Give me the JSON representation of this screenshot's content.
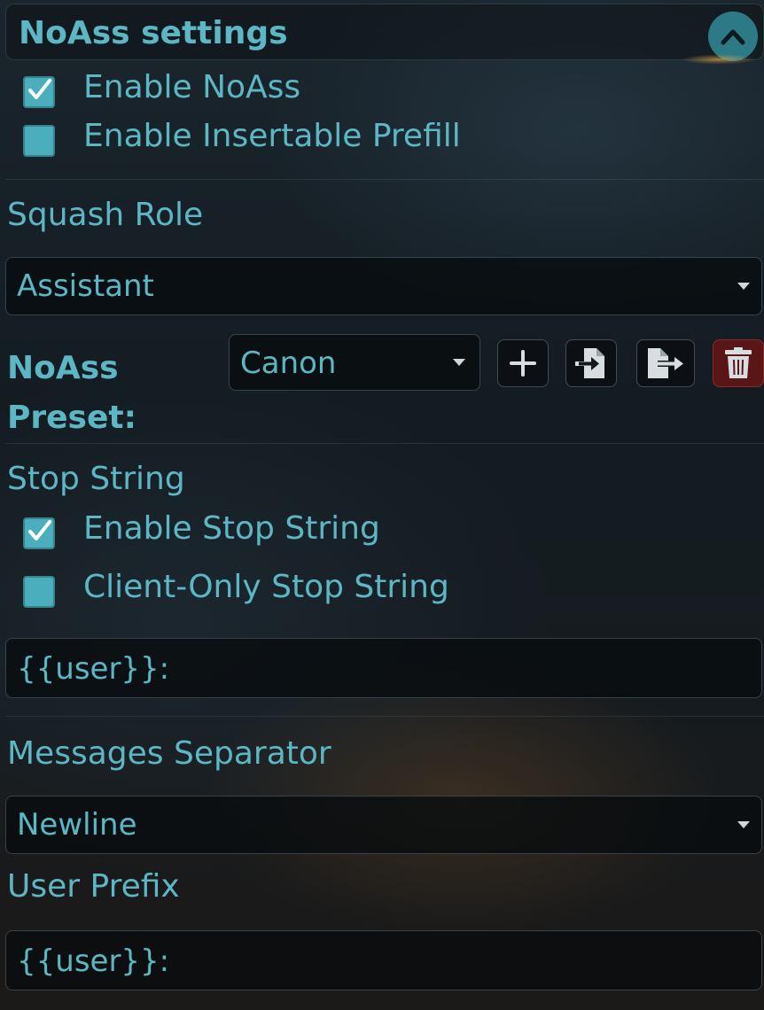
{
  "header": {
    "title": "NoAss settings",
    "collapse_icon": "chevron-up-icon"
  },
  "options": {
    "enable_noass": {
      "label": "Enable NoAss",
      "checked": true
    },
    "enable_insertable_prefill": {
      "label": "Enable Insertable Prefill",
      "checked": false
    }
  },
  "squash_role": {
    "label": "Squash Role",
    "selected": "Assistant"
  },
  "preset": {
    "label": "NoAss Preset:",
    "selected": "Canon",
    "buttons": [
      {
        "name": "add-preset-button",
        "icon": "plus-icon"
      },
      {
        "name": "import-preset-button",
        "icon": "file-import-icon"
      },
      {
        "name": "export-preset-button",
        "icon": "file-export-icon"
      },
      {
        "name": "delete-preset-button",
        "icon": "trash-icon"
      }
    ]
  },
  "stop_string": {
    "label": "Stop String",
    "enable": {
      "label": "Enable Stop String",
      "checked": true
    },
    "client_only": {
      "label": "Client-Only Stop String",
      "checked": false
    },
    "value": "{{user}}:"
  },
  "messages_separator": {
    "label": "Messages Separator",
    "selected": "Newline"
  },
  "user_prefix": {
    "label": "User Prefix",
    "value": "{{user}}:"
  },
  "colors": {
    "accent": "#5cb6c4",
    "checkbox": "#4aaebd",
    "collapse_button": "#2c7a86",
    "danger": "#5a1616"
  }
}
